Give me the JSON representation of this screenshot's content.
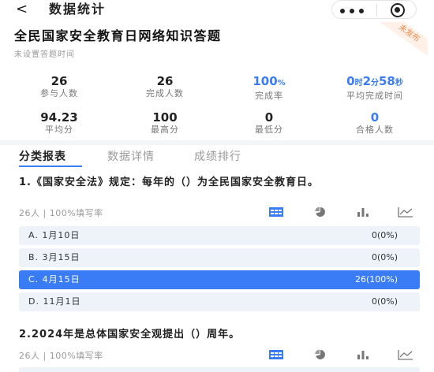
{
  "nav": {
    "back_glyph": "<",
    "title": "数据统计"
  },
  "header": {
    "title": "全民国家安全教育日网络知识答题",
    "time_note": "未设置答题时间",
    "status_ribbon": "未发布"
  },
  "stats": {
    "participants": {
      "value": "26",
      "label": "参与人数"
    },
    "completed": {
      "value": "26",
      "label": "完成人数"
    },
    "completion_rate": {
      "value": "100",
      "unit": "%",
      "label": "完成率"
    },
    "avg_time": {
      "h": "0",
      "h_unit": "时",
      "m": "2",
      "m_unit": "分",
      "s": "58",
      "s_unit": "秒",
      "label": "平均完成时间"
    },
    "avg_score": {
      "value": "94.23",
      "label": "平均分"
    },
    "max_score": {
      "value": "100",
      "label": "最高分"
    },
    "min_score": {
      "value": "0",
      "label": "最低分"
    },
    "pass_count": {
      "value": "0",
      "label": "合格人数"
    }
  },
  "tabs": [
    "分类报表",
    "数据详情",
    "成绩排行"
  ],
  "questions": [
    {
      "title": "1.《国家安全法》规定：每年的（）为全民国家安全教育日。",
      "meta": "26人 | 100%填写率",
      "options": [
        {
          "label": "A. 1月10日",
          "value": "0(0%)"
        },
        {
          "label": "B. 3月15日",
          "value": "0(0%)"
        },
        {
          "label": "C. 4月15日",
          "value": "26(100%)"
        },
        {
          "label": "D. 11月1日",
          "value": "0(0%)"
        }
      ]
    },
    {
      "title": "2.2024年是总体国家安全观提出（）周年。",
      "meta": "26人 | 100%填写率"
    }
  ],
  "icons": [
    "table-icon",
    "pie-chart-icon",
    "bar-chart-icon",
    "line-chart-icon"
  ],
  "colors": {
    "accent": "#3a7cf5",
    "option_bg": "#eef3fa",
    "ribbon": "#f08a4b"
  }
}
